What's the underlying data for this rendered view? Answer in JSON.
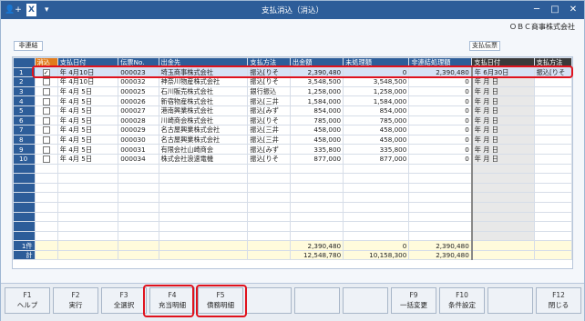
{
  "window": {
    "title": "支払消込（消込）",
    "company": "ＯＢＣ商事株式会社"
  },
  "groups": {
    "link": "非連結",
    "slip": "支払伝票"
  },
  "headers": [
    "消込",
    "支払日付",
    "伝票No.",
    "出金先",
    "支払方法",
    "出金額",
    "未処理額",
    "非連結処理額",
    "支払日付",
    "支払方法"
  ],
  "rows": [
    {
      "no": "1",
      "checked": "✓",
      "date": "年  4月10日",
      "slip": "000023",
      "payee": "埼玉商事株式会社",
      "method": "振込[りそ",
      "amount": "2,390,480",
      "unproc": "0",
      "nonlink": "2,390,480",
      "pdate": "年  6月30日",
      "pmethod": "振込[りそ"
    },
    {
      "no": "2",
      "checked": "",
      "date": "年  4月10日",
      "slip": "000032",
      "payee": "神奈川物産株式会社",
      "method": "振込[りそ",
      "amount": "3,548,500",
      "unproc": "3,548,500",
      "nonlink": "0",
      "pdate": "年   月   日",
      "pmethod": ""
    },
    {
      "no": "3",
      "checked": "",
      "date": "年  4月  5日",
      "slip": "000025",
      "payee": "石川販売株式会社",
      "method": "銀行振込",
      "amount": "1,258,000",
      "unproc": "1,258,000",
      "nonlink": "0",
      "pdate": "年   月   日",
      "pmethod": ""
    },
    {
      "no": "4",
      "checked": "",
      "date": "年  4月  5日",
      "slip": "000026",
      "payee": "新宿物産株式会社",
      "method": "振込[三井",
      "amount": "1,584,000",
      "unproc": "1,584,000",
      "nonlink": "0",
      "pdate": "年   月   日",
      "pmethod": ""
    },
    {
      "no": "5",
      "checked": "",
      "date": "年  4月  5日",
      "slip": "000027",
      "payee": "港南興業株式会社",
      "method": "振込[みず",
      "amount": "854,000",
      "unproc": "854,000",
      "nonlink": "0",
      "pdate": "年   月   日",
      "pmethod": ""
    },
    {
      "no": "6",
      "checked": "",
      "date": "年  4月  5日",
      "slip": "000028",
      "payee": "川崎商会株式会社",
      "method": "振込[りそ",
      "amount": "785,000",
      "unproc": "785,000",
      "nonlink": "0",
      "pdate": "年   月   日",
      "pmethod": ""
    },
    {
      "no": "7",
      "checked": "",
      "date": "年  4月  5日",
      "slip": "000029",
      "payee": "名古屋興業株式会社",
      "method": "振込[三井",
      "amount": "458,000",
      "unproc": "458,000",
      "nonlink": "0",
      "pdate": "年   月   日",
      "pmethod": ""
    },
    {
      "no": "8",
      "checked": "",
      "date": "年  4月  5日",
      "slip": "000030",
      "payee": "名古屋興業株式会社",
      "method": "振込[三井",
      "amount": "458,000",
      "unproc": "458,000",
      "nonlink": "0",
      "pdate": "年   月   日",
      "pmethod": ""
    },
    {
      "no": "9",
      "checked": "",
      "date": "年  4月  5日",
      "slip": "000031",
      "payee": "有限会社山崎商会",
      "method": "振込[みず",
      "amount": "335,800",
      "unproc": "335,800",
      "nonlink": "0",
      "pdate": "年   月   日",
      "pmethod": ""
    },
    {
      "no": "10",
      "checked": "",
      "date": "年  4月  5日",
      "slip": "000034",
      "payee": "株式会社浪速電機",
      "method": "振込[りそ",
      "amount": "877,000",
      "unproc": "877,000",
      "nonlink": "0",
      "pdate": "年   月   日",
      "pmethod": ""
    }
  ],
  "summary": {
    "sel_label": "1件",
    "sel_amount": "2,390,480",
    "sel_unproc": "0",
    "sel_nonlink": "2,390,480",
    "total_label": "計",
    "total_amount": "12,548,780",
    "total_unproc": "10,158,300",
    "total_nonlink": "2,390,480"
  },
  "fkeys": [
    {
      "key": "F1",
      "label": "ヘルプ"
    },
    {
      "key": "F2",
      "label": "実行"
    },
    {
      "key": "F3",
      "label": "全選択"
    },
    {
      "key": "F4",
      "label": "充当明細"
    },
    {
      "key": "F5",
      "label": "債務明細"
    },
    {
      "key": "",
      "label": ""
    },
    {
      "key": "",
      "label": ""
    },
    {
      "key": "",
      "label": ""
    },
    {
      "key": "F9",
      "label": "一括変更"
    },
    {
      "key": "F10",
      "label": "条件設定"
    },
    {
      "key": "",
      "label": ""
    },
    {
      "key": "F12",
      "label": "閉じる"
    }
  ]
}
